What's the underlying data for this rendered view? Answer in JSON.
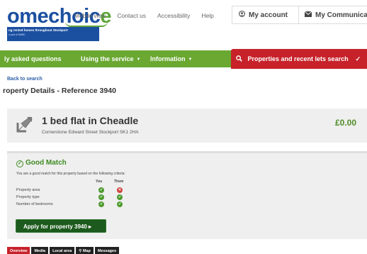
{
  "logo": {
    "name_part1": "omechoic",
    "name_part2": "e",
    "tagline": "ng rented homes throughout Stockport",
    "subtag": "a part of SMBC"
  },
  "toplinks": [
    "Mobile view",
    "Contact us",
    "Accessibility",
    "Help"
  ],
  "account": {
    "label": "My account",
    "icon": "user-circle-icon"
  },
  "communications": {
    "label": "My Communications",
    "icon": "envelope-icon"
  },
  "nav": {
    "faq": "ly asked questions",
    "using": "Using the service",
    "information": "Information",
    "search_tab": "Properties and recent lets search"
  },
  "breadcrumb": {
    "back": "Back to search"
  },
  "page_title": "roperty Details - Reference 3940",
  "property": {
    "name": "1 bed flat in Cheadle",
    "address": "Cornerstone Edward Street Stockport SK1 2HA",
    "price": "£0.00"
  },
  "match": {
    "title": "Good Match",
    "description": "You are a good match for this property based on the following criteria:",
    "col_you": "You",
    "col_them": "Them",
    "criteria": [
      {
        "label": "Property area",
        "you": true,
        "them": false
      },
      {
        "label": "Property type",
        "you": true,
        "them": true
      },
      {
        "label": "Number of bedrooms",
        "you": true,
        "them": true
      }
    ],
    "apply_label": "Apply for property 3940 ▸"
  },
  "tabs": [
    "Overview",
    "Media",
    "Local area",
    "Map",
    "Messages"
  ],
  "colors": {
    "brand_blue": "#1b4fa0",
    "nav_green": "#6aa832",
    "search_red": "#c7222a",
    "match_green": "#3e8a22",
    "no_red": "#d0413c"
  }
}
